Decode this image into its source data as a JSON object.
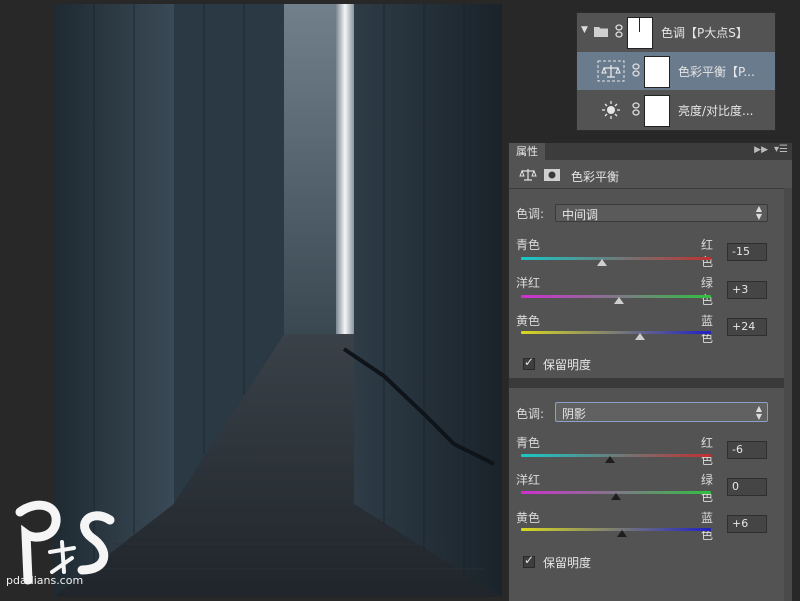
{
  "layers_panel": {
    "group": {
      "name": "色调【P大点S】",
      "expanded": true
    },
    "layers": [
      {
        "name": "色彩平衡【P...",
        "type": "color-balance",
        "selected": true
      },
      {
        "name": "亮度/对比度...",
        "type": "brightness-contrast",
        "selected": false
      }
    ]
  },
  "properties_panel": {
    "tab": "属性",
    "title": "色彩平衡",
    "sections": [
      {
        "tone_label": "色调:",
        "tone_value": "中间调",
        "sliders": [
          {
            "left": "青色",
            "right": "红色",
            "value": "-15",
            "level": -15
          },
          {
            "left": "洋红",
            "right": "绿色",
            "value": "+3",
            "level": 3
          },
          {
            "left": "黄色",
            "right": "蓝色",
            "value": "+24",
            "level": 24
          }
        ],
        "preserve_luminosity": "保留明度"
      },
      {
        "tone_label": "色调:",
        "tone_value": "阴影",
        "sliders": [
          {
            "left": "青色",
            "right": "红色",
            "value": "-6",
            "level": -6
          },
          {
            "left": "洋红",
            "right": "绿色",
            "value": "0",
            "level": 0
          },
          {
            "left": "黄色",
            "right": "蓝色",
            "value": "+6",
            "level": 6
          }
        ],
        "preserve_luminosity": "保留明度"
      }
    ]
  },
  "watermark": {
    "url": "pdadians.com"
  },
  "colors": {
    "panel": "#535353",
    "selected_layer": "#6b7b8e",
    "background": "#282828"
  }
}
